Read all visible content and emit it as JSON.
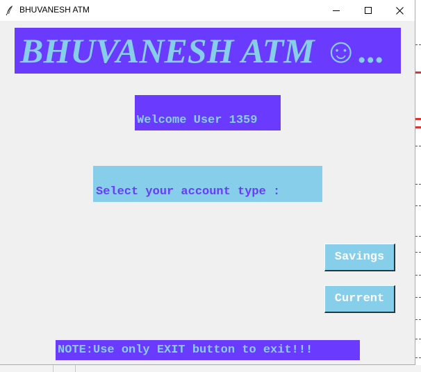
{
  "window": {
    "title": "BHUVANESH ATM"
  },
  "banner": {
    "text": "BHUVANESH ATM ☺..."
  },
  "welcome": {
    "text": "Welcome User 1359"
  },
  "prompt": {
    "text": "Select your account type :"
  },
  "buttons": {
    "savings_label": "Savings",
    "current_label": "Current"
  },
  "note": {
    "text": "NOTE:Use only EXIT button to exit!!!"
  },
  "icons": {
    "app": "feather-icon",
    "minimize": "minimize-icon",
    "maximize": "maximize-icon",
    "close": "close-icon"
  },
  "colors": {
    "purple": "#6a3bff",
    "sky_blue": "#87ceeb",
    "window_bg": "#f0f0f0"
  }
}
